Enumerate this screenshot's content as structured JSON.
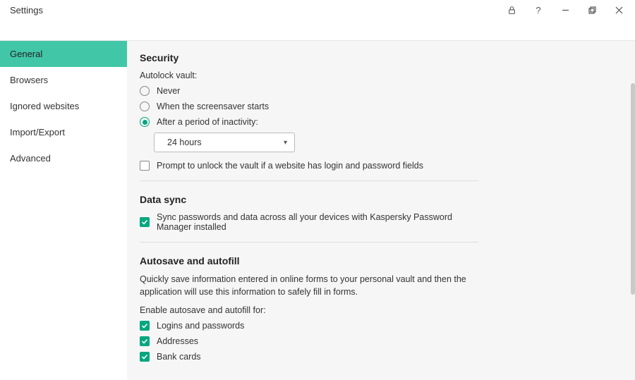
{
  "titlebar": {
    "title": "Settings"
  },
  "sidebar": {
    "items": [
      {
        "label": "General",
        "active": true
      },
      {
        "label": "Browsers",
        "active": false
      },
      {
        "label": "Ignored websites",
        "active": false
      },
      {
        "label": "Import/Export",
        "active": false
      },
      {
        "label": "Advanced",
        "active": false
      }
    ]
  },
  "security": {
    "heading": "Security",
    "autolock_label": "Autolock vault:",
    "options": {
      "never": "Never",
      "screensaver": "When the screensaver starts",
      "inactivity": "After a period of inactivity:"
    },
    "inactivity_value": "24 hours",
    "prompt_unlock": "Prompt to unlock the vault if a website has login and password fields"
  },
  "datasync": {
    "heading": "Data sync",
    "sync_label": "Sync passwords and data across all your devices with Kaspersky Password Manager installed"
  },
  "autosave": {
    "heading": "Autosave and autofill",
    "desc": "Quickly save information entered in online forms to your personal vault and then the application will use this information to safely fill in forms.",
    "enable_label": "Enable autosave and autofill for:",
    "items": {
      "logins": "Logins and passwords",
      "addresses": "Addresses",
      "bankcards": "Bank cards"
    }
  }
}
